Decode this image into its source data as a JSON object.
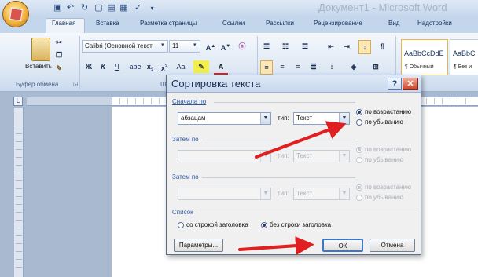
{
  "window": {
    "title": "Документ1 - Microsoft Word"
  },
  "tabs": [
    "Главная",
    "Вставка",
    "Разметка страницы",
    "Ссылки",
    "Рассылки",
    "Рецензирование",
    "Вид",
    "Надстройки"
  ],
  "ribbon": {
    "clipboard": {
      "paste_label": "Вставить",
      "group_label": "Буфер обмена"
    },
    "font": {
      "font_name": "Calibri (Основной текст",
      "font_size": "11",
      "group_label_partial": "Шри"
    },
    "styles": [
      {
        "sample": "AaBbCcDdE",
        "name": "¶ Обычный"
      },
      {
        "sample": "AaBbC",
        "name": "¶ Без и"
      }
    ]
  },
  "dialog": {
    "title": "Сортировка текста",
    "help": "?",
    "close": "✕",
    "first": {
      "label": "Сначала по",
      "field_value": "абзацам",
      "type_label": "тип:",
      "type_value": "Текст",
      "asc": "по возрастанию",
      "desc": "по убыванию",
      "selected": "asc"
    },
    "second": {
      "label": "Затем по",
      "field_value": "",
      "type_label": "тип:",
      "type_value": "Текст",
      "asc": "по возрастанию",
      "desc": "по убыванию"
    },
    "third": {
      "label": "Затем по",
      "field_value": "",
      "type_label": "тип:",
      "type_value": "Текст",
      "asc": "по возрастанию",
      "desc": "по убыванию"
    },
    "list": {
      "label": "Список",
      "with_header": "со строкой заголовка",
      "without_header": "без строки заголовка",
      "selected": "without_header"
    },
    "buttons": {
      "options": "Параметры...",
      "ok": "ОК",
      "cancel": "Отмена"
    }
  },
  "colors": {
    "annotation_arrow": "#e02020",
    "dialog_title": "#1b2f55"
  }
}
